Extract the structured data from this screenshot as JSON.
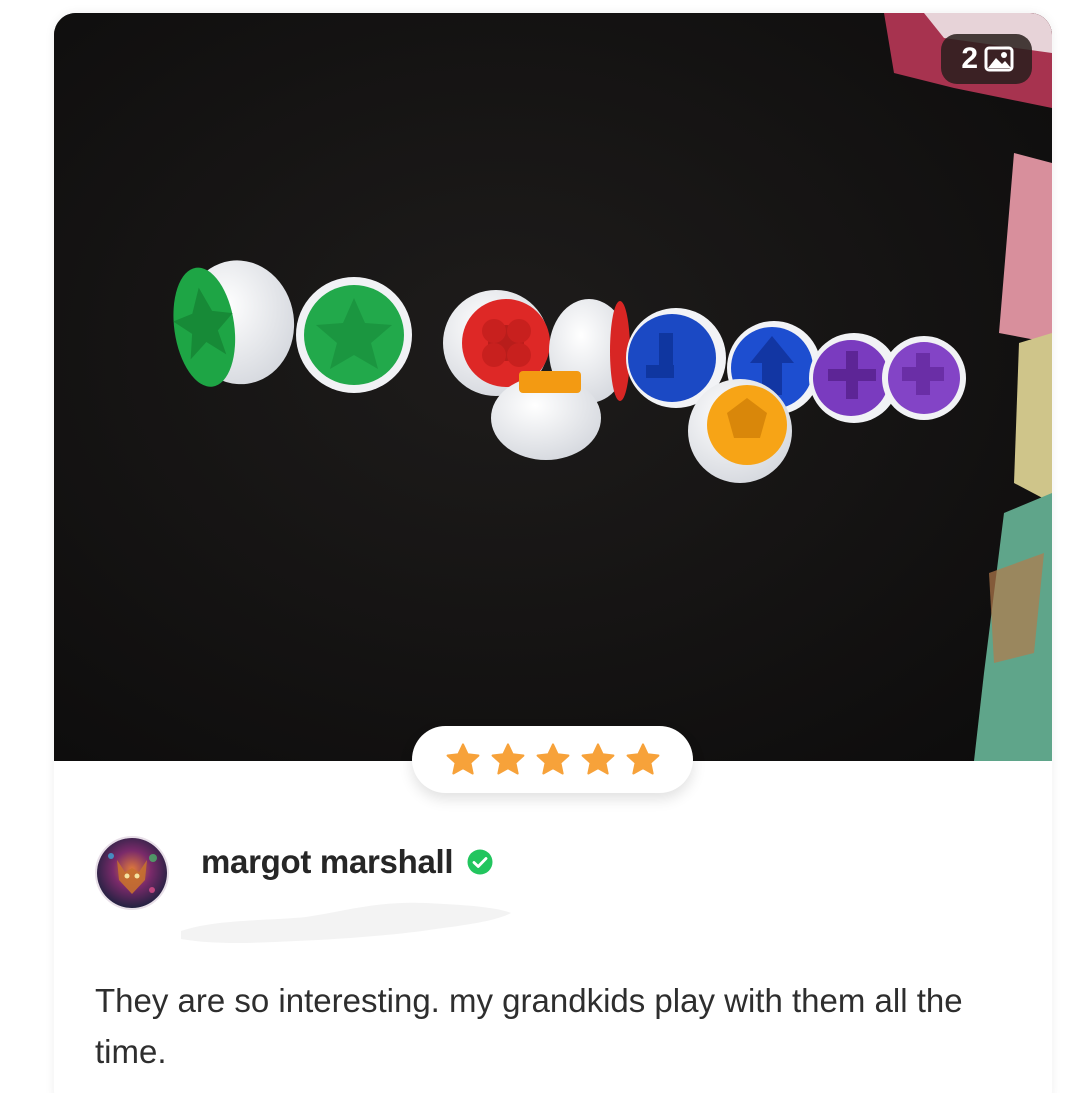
{
  "review": {
    "image_count": "2",
    "rating": 5,
    "reviewer_name": "margot marshall",
    "verified": true,
    "text": "They are so interesting. my grandkids play with them all the time."
  },
  "icons": {
    "gallery": "image-icon",
    "star": "star-icon",
    "verified": "verified-check-icon"
  },
  "colors": {
    "star": "#F7A23A",
    "verified": "#22C55E",
    "name_text": "#262626",
    "body_text": "#2e2e2e"
  }
}
